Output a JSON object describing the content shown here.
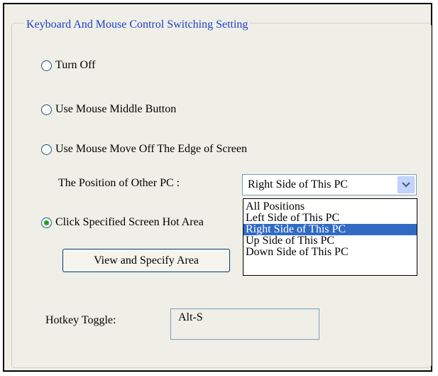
{
  "group": {
    "title": "Keyboard And Mouse Control Switching Setting"
  },
  "options": {
    "turn_off": "Turn Off",
    "middle_button": "Use Mouse Middle Button",
    "edge": "Use Mouse Move Off The Edge of Screen",
    "hot_area": "Click Specified Screen Hot Area",
    "selected": "hot_area"
  },
  "position": {
    "label": "The Position of Other PC :",
    "value": "Right Side of This PC",
    "items": [
      "All Positions",
      "Left Side of This PC",
      "Right Side of This PC",
      "Up Side of This PC",
      "Down Side of This PC"
    ],
    "highlighted": "Right Side of This PC"
  },
  "view_button": "View and Specify Area",
  "hotkey": {
    "label": "Hotkey Toggle:",
    "value": "Alt-S"
  },
  "colors": {
    "title": "#1e3fc8",
    "highlight": "#316ac5",
    "radio_dot": "#21a121"
  }
}
